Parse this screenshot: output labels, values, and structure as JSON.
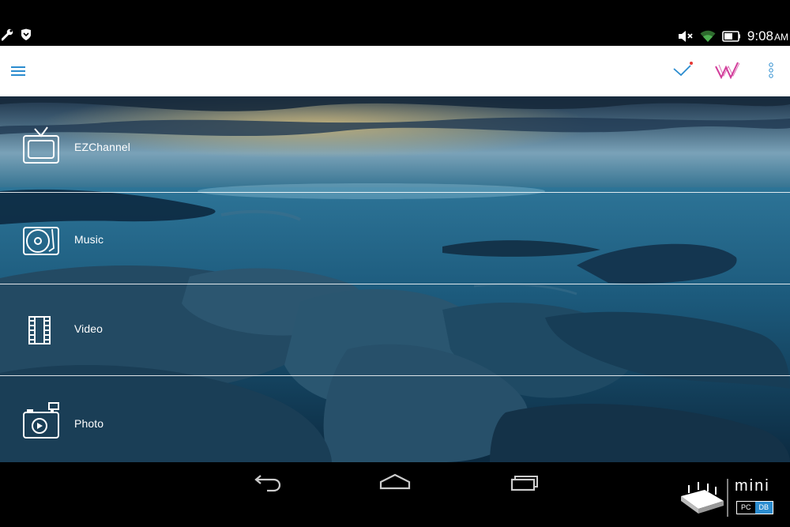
{
  "status_bar": {
    "left_icons": [
      "wrench-icon",
      "shield-icon"
    ],
    "right_icons": [
      "volume-muted-icon",
      "wifi-icon",
      "battery-icon"
    ],
    "time": "9:08",
    "ampm": "AM"
  },
  "app_bar": {
    "menu_icon": "hamburger-menu-icon",
    "actions": [
      "check-notification-icon",
      "w-logo-icon",
      "overflow-menu-icon"
    ]
  },
  "menu": {
    "items": [
      {
        "label": "EZChannel",
        "icon": "tv-icon"
      },
      {
        "label": "Music",
        "icon": "music-disc-icon"
      },
      {
        "label": "Video",
        "icon": "film-strip-icon"
      },
      {
        "label": "Photo",
        "icon": "camera-icon"
      }
    ]
  },
  "nav_bar": {
    "buttons": [
      "back-icon",
      "home-icon",
      "recent-apps-icon"
    ]
  },
  "watermark": {
    "mini": "mini",
    "pc": "PC",
    "db": "DB"
  },
  "colors": {
    "accent": "#2b8ccf",
    "w_logo": "#d23c9a",
    "notification_dot": "#e53935"
  }
}
